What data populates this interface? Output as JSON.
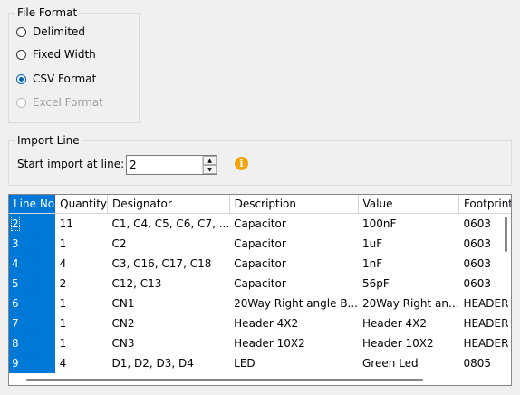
{
  "file_format": {
    "title": "File Format",
    "options": [
      {
        "label": "Delimited",
        "checked": false,
        "enabled": true
      },
      {
        "label": "Fixed Width",
        "checked": false,
        "enabled": true
      },
      {
        "label": "CSV Format",
        "checked": true,
        "enabled": true
      },
      {
        "label": "Excel Format",
        "checked": false,
        "enabled": false
      }
    ]
  },
  "import_line": {
    "title": "Import Line",
    "start_label": "Start import at line:",
    "start_value": "2",
    "info_icon": "info-icon"
  },
  "table": {
    "columns": [
      "Line No",
      "Quantity",
      "Designator",
      "Description",
      "Value",
      "Footprint"
    ],
    "rows": [
      [
        "2",
        "11",
        "C1, C4, C5, C6, C7, ...",
        "Capacitor",
        "100nF",
        "0603"
      ],
      [
        "3",
        "1",
        "C2",
        "Capacitor",
        "1uF",
        "0603"
      ],
      [
        "4",
        "4",
        "C3, C16, C17, C18",
        "Capacitor",
        "1nF",
        "0603"
      ],
      [
        "5",
        "2",
        "C12, C13",
        "Capacitor",
        "56pF",
        "0603"
      ],
      [
        "6",
        "1",
        "CN1",
        "20Way Right angle B...",
        "20Way Right an...",
        "HEADER IDC"
      ],
      [
        "7",
        "1",
        "CN2",
        "Header 4X2",
        "Header 4X2",
        "HEADER IDC"
      ],
      [
        "8",
        "1",
        "CN3",
        "Header 10X2",
        "Header 10X2",
        "HEADER IDC"
      ],
      [
        "9",
        "4",
        "D1, D2, D3, D4",
        "LED",
        "Green Led",
        "0805"
      ]
    ]
  },
  "colors": {
    "selection": "#0078d7",
    "radio_checked": "#005fb8",
    "info": "#f0a30a"
  }
}
